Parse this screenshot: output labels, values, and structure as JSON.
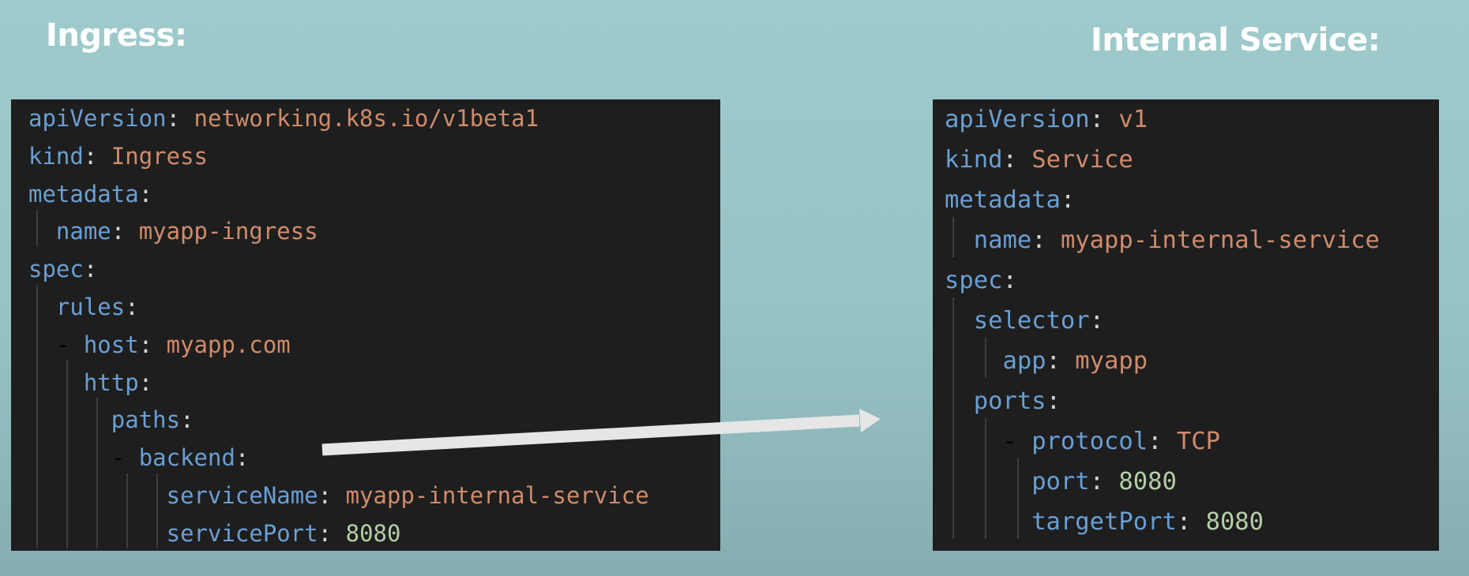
{
  "titles": {
    "left": "Ingress:",
    "right": "Internal Service:"
  },
  "ingress_yaml": [
    {
      "indent": 0,
      "key": "apiVersion",
      "value": "networking.k8s.io/v1beta1",
      "value_type": "string"
    },
    {
      "indent": 0,
      "key": "kind",
      "value": "Ingress",
      "value_type": "string"
    },
    {
      "indent": 0,
      "key": "metadata",
      "value": "",
      "value_type": "none"
    },
    {
      "indent": 1,
      "key": "name",
      "value": "myapp-ingress",
      "value_type": "string"
    },
    {
      "indent": 0,
      "key": "spec",
      "value": "",
      "value_type": "none"
    },
    {
      "indent": 1,
      "key": "rules",
      "value": "",
      "value_type": "none"
    },
    {
      "indent": 1,
      "dash": true,
      "key": "host",
      "value": "myapp.com",
      "value_type": "string"
    },
    {
      "indent": 2,
      "key": "http",
      "value": "",
      "value_type": "none"
    },
    {
      "indent": 3,
      "key": "paths",
      "value": "",
      "value_type": "none"
    },
    {
      "indent": 3,
      "dash": true,
      "key": "backend",
      "value": "",
      "value_type": "none"
    },
    {
      "indent": 5,
      "key": "serviceName",
      "value": "myapp-internal-service",
      "value_type": "string"
    },
    {
      "indent": 5,
      "key": "servicePort",
      "value": "8080",
      "value_type": "number"
    }
  ],
  "service_yaml": [
    {
      "indent": 0,
      "key": "apiVersion",
      "value": "v1",
      "value_type": "string"
    },
    {
      "indent": 0,
      "key": "kind",
      "value": "Service",
      "value_type": "string"
    },
    {
      "indent": 0,
      "key": "metadata",
      "value": "",
      "value_type": "none"
    },
    {
      "indent": 1,
      "key": "name",
      "value": "myapp-internal-service",
      "value_type": "string"
    },
    {
      "indent": 0,
      "key": "spec",
      "value": "",
      "value_type": "none"
    },
    {
      "indent": 1,
      "key": "selector",
      "value": "",
      "value_type": "none"
    },
    {
      "indent": 2,
      "key": "app",
      "value": "myapp",
      "value_type": "string"
    },
    {
      "indent": 1,
      "key": "ports",
      "value": "",
      "value_type": "none"
    },
    {
      "indent": 2,
      "dash": true,
      "key": "protocol",
      "value": "TCP",
      "value_type": "string"
    },
    {
      "indent": 3,
      "key": "port",
      "value": "8080",
      "value_type": "number"
    },
    {
      "indent": 3,
      "key": "targetPort",
      "value": "8080",
      "value_type": "number"
    }
  ],
  "colors": {
    "background": "#9fcacc",
    "editor_background": "#1e1e1e",
    "yaml_key": "#6a9fd4",
    "yaml_string": "#d08b6b",
    "yaml_number": "#b5cea8",
    "punctuation": "#d4d4d4",
    "arrow": "#e6e6e6"
  }
}
